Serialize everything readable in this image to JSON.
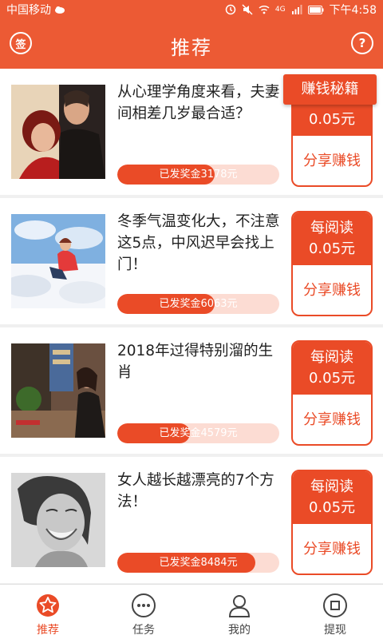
{
  "status_bar": {
    "carrier": "中国移动",
    "time": "下午4:58",
    "network": "4G"
  },
  "header": {
    "title": "推荐",
    "sign_label": "签",
    "help_label": "?"
  },
  "floating_button": "赚钱秘籍",
  "reward_labels": {
    "per_read": "每阅读",
    "amount": "0.05元",
    "share": "分享赚钱"
  },
  "articles": [
    {
      "title": "从心理学角度来看，夫妻间相差几岁最合适？",
      "paid": "已发奖金3178元",
      "progress": 0.6,
      "image": "couple-photo"
    },
    {
      "title": "冬季气温变化大，不注意这5点，中风迟早会找上门！",
      "paid": "已发奖金6063元",
      "progress": 0.6,
      "image": "snow-photo"
    },
    {
      "title": "2018年过得特别溜的生肖",
      "paid": "已发奖金4579元",
      "progress": 0.45,
      "image": "street-photo"
    },
    {
      "title": "女人越长越漂亮的7个方法！",
      "paid": "已发奖金8484元",
      "progress": 0.85,
      "image": "woman-laughing-photo"
    }
  ],
  "tabs": [
    {
      "label": "推荐",
      "icon": "star-icon",
      "active": true
    },
    {
      "label": "任务",
      "icon": "dots-icon",
      "active": false
    },
    {
      "label": "我的",
      "icon": "person-icon",
      "active": false
    },
    {
      "label": "提现",
      "icon": "withdraw-icon",
      "active": false
    }
  ],
  "colors": {
    "brand": "#ec5a34",
    "accent": "#ea4b27",
    "progress_bg": "#fcdcd3"
  }
}
